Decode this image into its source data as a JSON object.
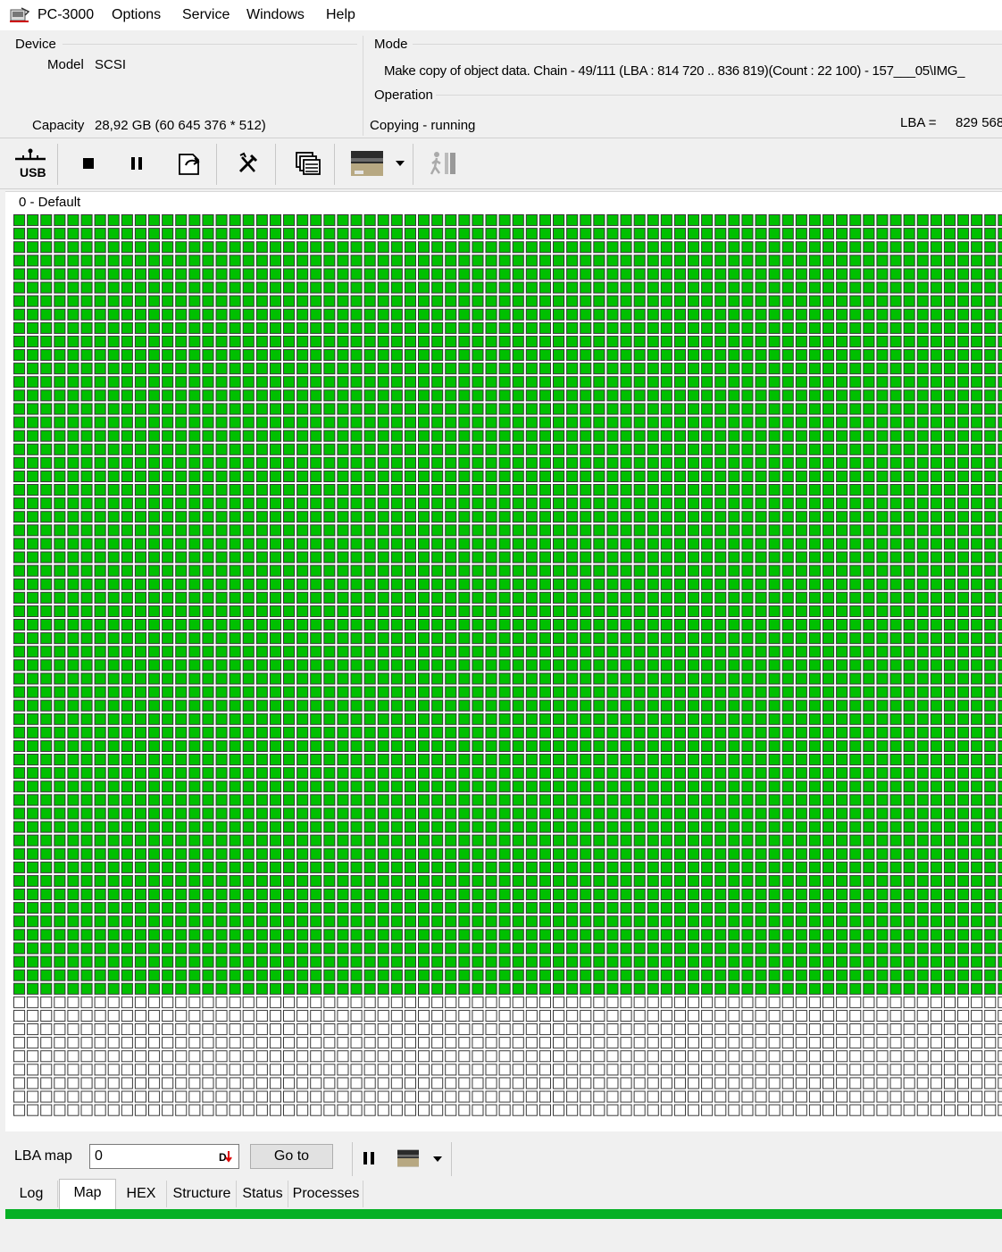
{
  "menu": {
    "app": "PC-3000",
    "items": [
      "Options",
      "Service",
      "Windows",
      "Help"
    ]
  },
  "device": {
    "label": "Device",
    "model_label": "Model",
    "model_value": "SCSI",
    "capacity_label": "Capacity",
    "capacity_value": "28,92 GB (60 645 376 * 512)"
  },
  "mode": {
    "label": "Mode",
    "text": "Make copy of object data. Chain - 49/111 (LBA : 814 720 .. 836 819)(Count :  22 100) - 157___05\\IMG_"
  },
  "operation": {
    "label": "Operation",
    "status": "Copying - running",
    "lba_label": "LBA =",
    "lba_value": "829 568"
  },
  "toolbar": {
    "usb_label": "USB",
    "icons": [
      "usb-icon",
      "stop-icon",
      "pause-icon",
      "export-icon",
      "tools-icon",
      "windows-icon",
      "drive-image-icon",
      "dropdown-arrow-icon",
      "run-icon"
    ]
  },
  "map": {
    "title": "0 - Default",
    "colors": {
      "done": "#00c000",
      "pending": "#ffffff",
      "border": "#3a3a3a"
    },
    "completed_rows": 58,
    "total_rows": 67
  },
  "bottom": {
    "lba_map_label": "LBA map",
    "lba_value": "0",
    "goto_label": "Go to",
    "icons": [
      "pause-icon",
      "drive-image-icon",
      "dropdown-arrow-icon"
    ]
  },
  "tabs": [
    "Log",
    "Map",
    "HEX",
    "Structure",
    "Status",
    "Processes"
  ],
  "active_tab": "Map",
  "progress_fraction": 1.0
}
